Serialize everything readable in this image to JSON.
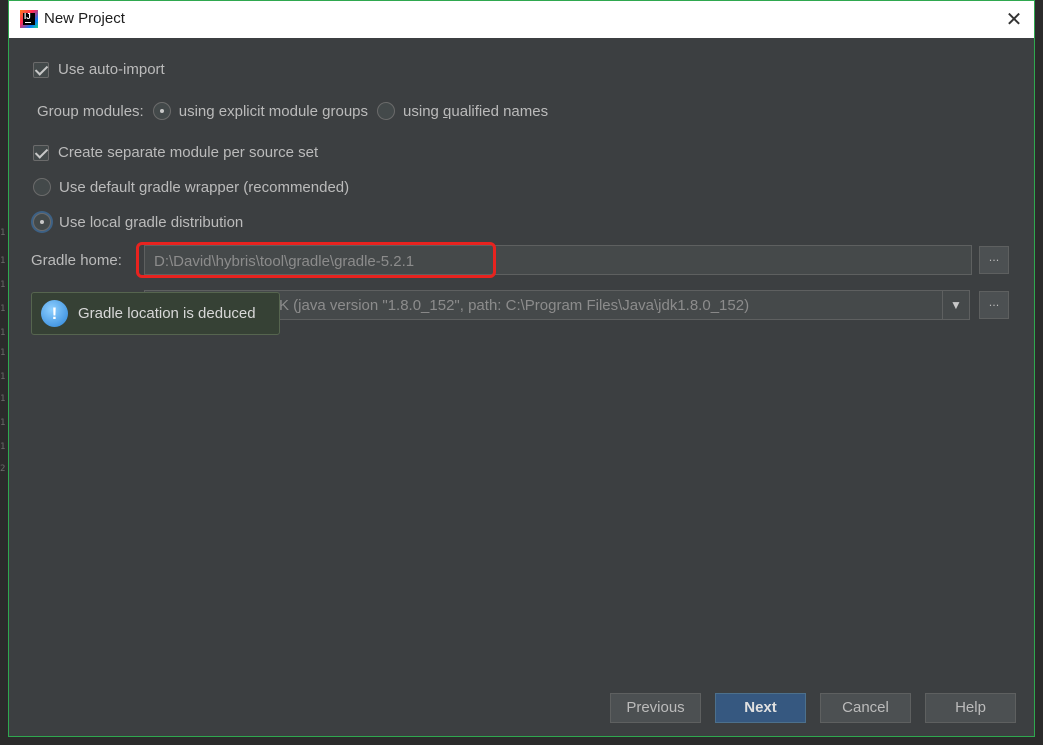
{
  "window": {
    "title": "New Project",
    "close_glyph": "✕",
    "border_color": "#2fa84f",
    "app_icon_text": "IJ"
  },
  "options": {
    "auto_import": {
      "label": "Use auto-import",
      "checked": true
    },
    "group_modules": {
      "label": "Group modules:",
      "explicit": {
        "label": "using explicit module groups",
        "selected": true
      },
      "qualified": {
        "label_pre": "using ",
        "label_underline": "q",
        "label_post": "ualified names",
        "selected": false
      }
    },
    "separate_module": {
      "label": "Create separate module per source set",
      "checked": true
    },
    "default_wrapper": {
      "label": "Use default gradle wrapper (recommended)",
      "selected": false
    },
    "local_distribution": {
      "label": "Use local gradle distribution",
      "selected": true
    }
  },
  "gradle_home": {
    "label": "Gradle home:",
    "value": "D:\\David\\hybris\\tool\\gradle\\gradle-5.2.1",
    "browse_label": "...",
    "highlight_color": "#e8231f"
  },
  "gradle_jvm": {
    "value_visible": "K (java version \"1.8.0_152\", path: C:\\Program Files\\Java\\jdk1.8.0_152)",
    "dropdown_glyph": "▼",
    "browse_label": "..."
  },
  "balloon": {
    "icon_glyph": "!",
    "text": "Gradle location is deduced"
  },
  "footer": {
    "previous": "Previous",
    "next": "Next",
    "cancel": "Cancel",
    "help": "Help"
  },
  "gutter": [
    "1",
    "1",
    "1",
    "1",
    "1",
    "1",
    "1",
    "1",
    "1",
    "1",
    "2"
  ]
}
